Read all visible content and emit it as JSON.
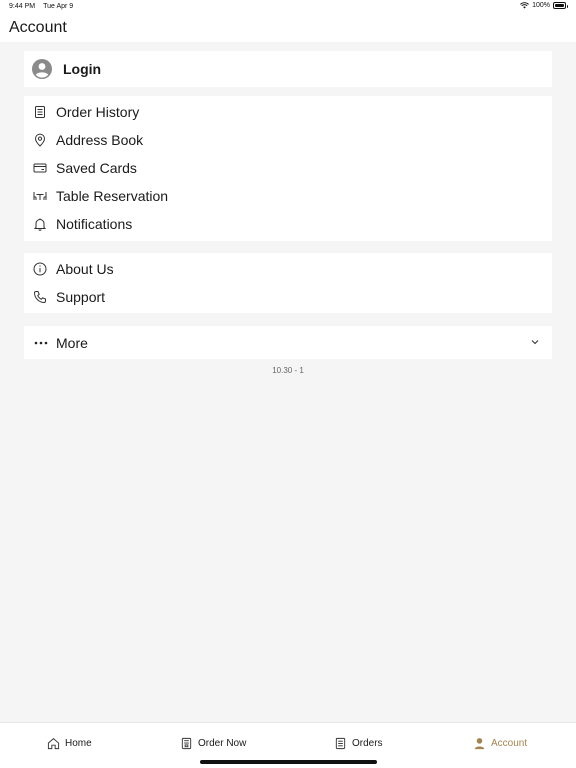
{
  "status_bar": {
    "time": "9:44 PM",
    "date": "Tue Apr 9",
    "battery": "100%",
    "wifi_icon": "wifi-icon",
    "battery_icon": "battery-icon"
  },
  "header": {
    "title": "Account"
  },
  "login": {
    "label": "Login",
    "icon": "user-avatar-icon"
  },
  "menu_main": [
    {
      "label": "Order History",
      "icon": "receipt-icon"
    },
    {
      "label": "Address Book",
      "icon": "location-pin-icon"
    },
    {
      "label": "Saved Cards",
      "icon": "credit-card-icon"
    },
    {
      "label": "Table Reservation",
      "icon": "dining-table-icon"
    },
    {
      "label": "Notifications",
      "icon": "bell-icon"
    }
  ],
  "menu_info": [
    {
      "label": "About Us",
      "icon": "info-icon"
    },
    {
      "label": "Support",
      "icon": "phone-icon"
    }
  ],
  "more": {
    "label": "More",
    "icon": "more-dots-icon"
  },
  "version": "10.30 - 1",
  "tabbar": {
    "home": "Home",
    "order_now": "Order Now",
    "orders": "Orders",
    "account": "Account",
    "active": "Account",
    "active_color": "#a08451"
  }
}
